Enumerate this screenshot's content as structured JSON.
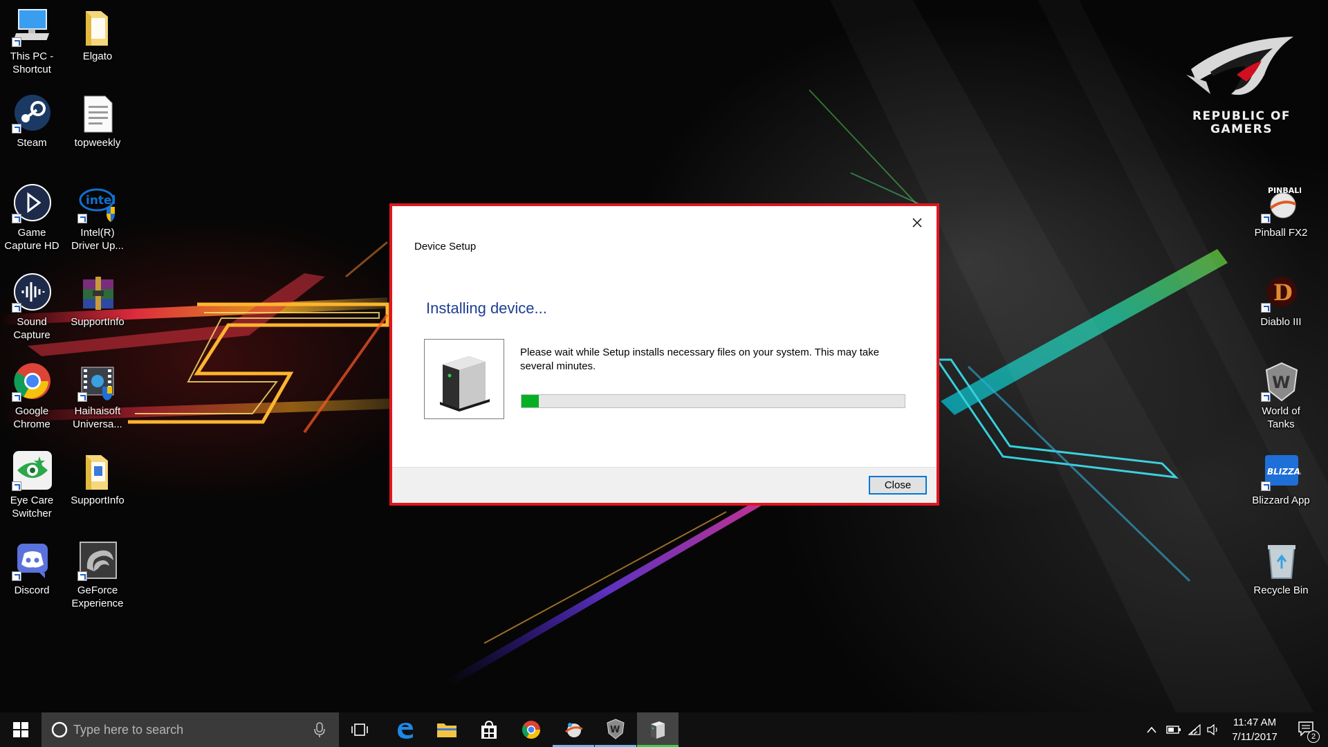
{
  "desktop": {
    "left_icons": [
      {
        "label": "This PC - Shortcut",
        "icon": "this-pc-icon",
        "name": "desktop-icon-this-pc"
      },
      {
        "label": "Elgato",
        "icon": "folder-icon",
        "name": "desktop-icon-elgato"
      },
      {
        "label": "Steam",
        "icon": "steam-icon",
        "name": "desktop-icon-steam"
      },
      {
        "label": "topweekly",
        "icon": "document-icon",
        "name": "desktop-icon-topweekly"
      },
      {
        "label": "Game Capture HD",
        "icon": "game-capture-icon",
        "name": "desktop-icon-game-capture-hd"
      },
      {
        "label": "Intel(R) Driver Up...",
        "icon": "intel-icon",
        "name": "desktop-icon-intel-driver"
      },
      {
        "label": "Sound Capture",
        "icon": "sound-capture-icon",
        "name": "desktop-icon-sound-capture"
      },
      {
        "label": "SupportInfo",
        "icon": "winrar-icon",
        "name": "desktop-icon-supportinfo-archive"
      },
      {
        "label": "Google Chrome",
        "icon": "chrome-icon",
        "name": "desktop-icon-google-chrome"
      },
      {
        "label": "Haihaisoft Universa...",
        "icon": "haihaisoft-icon",
        "name": "desktop-icon-haihaisoft"
      },
      {
        "label": "Eye Care Switcher",
        "icon": "eye-care-icon",
        "name": "desktop-icon-eye-care"
      },
      {
        "label": "SupportInfo",
        "icon": "folder-icon",
        "name": "desktop-icon-supportinfo-folder"
      },
      {
        "label": "Discord",
        "icon": "discord-icon",
        "name": "desktop-icon-discord"
      },
      {
        "label": "GeForce Experience",
        "icon": "geforce-icon",
        "name": "desktop-icon-geforce"
      }
    ],
    "right_icons": [
      {
        "label": "Pinball FX2",
        "icon": "pinball-icon",
        "name": "desktop-icon-pinball-fx2"
      },
      {
        "label": "Diablo III",
        "icon": "diablo-icon",
        "name": "desktop-icon-diablo-iii"
      },
      {
        "label": "World of Tanks",
        "icon": "world-of-tanks-icon",
        "name": "desktop-icon-world-of-tanks"
      },
      {
        "label": "Blizzard App",
        "icon": "blizzard-icon",
        "name": "desktop-icon-blizzard-app"
      },
      {
        "label": "Recycle Bin",
        "icon": "recycle-bin-icon",
        "name": "desktop-icon-recycle-bin"
      }
    ],
    "logo": {
      "line1": "REPUBLIC OF",
      "line2": "GAMERS"
    }
  },
  "dialog": {
    "title": "Device Setup",
    "heading": "Installing device...",
    "message": "Please wait while Setup installs necessary files on your system. This may take several minutes.",
    "progress_fraction": 0.045,
    "close_button_label": "Close",
    "border_color": "#e0151e",
    "heading_color": "#1c3f94",
    "progress_color": "#06b025"
  },
  "taskbar": {
    "search_placeholder": "Type here to search",
    "apps": [
      {
        "icon": "edge-icon",
        "name": "taskbar-edge"
      },
      {
        "icon": "file-explorer-icon",
        "name": "taskbar-file-explorer"
      },
      {
        "icon": "store-icon",
        "name": "taskbar-store"
      },
      {
        "icon": "chrome-icon",
        "name": "taskbar-chrome"
      },
      {
        "icon": "pinball-icon",
        "name": "taskbar-pinball"
      },
      {
        "icon": "world-of-tanks-icon",
        "name": "taskbar-world-of-tanks"
      },
      {
        "icon": "device-setup-icon",
        "name": "taskbar-device-setup"
      }
    ],
    "time": "11:47 AM",
    "date": "7/11/2017",
    "notification_count": "2"
  }
}
